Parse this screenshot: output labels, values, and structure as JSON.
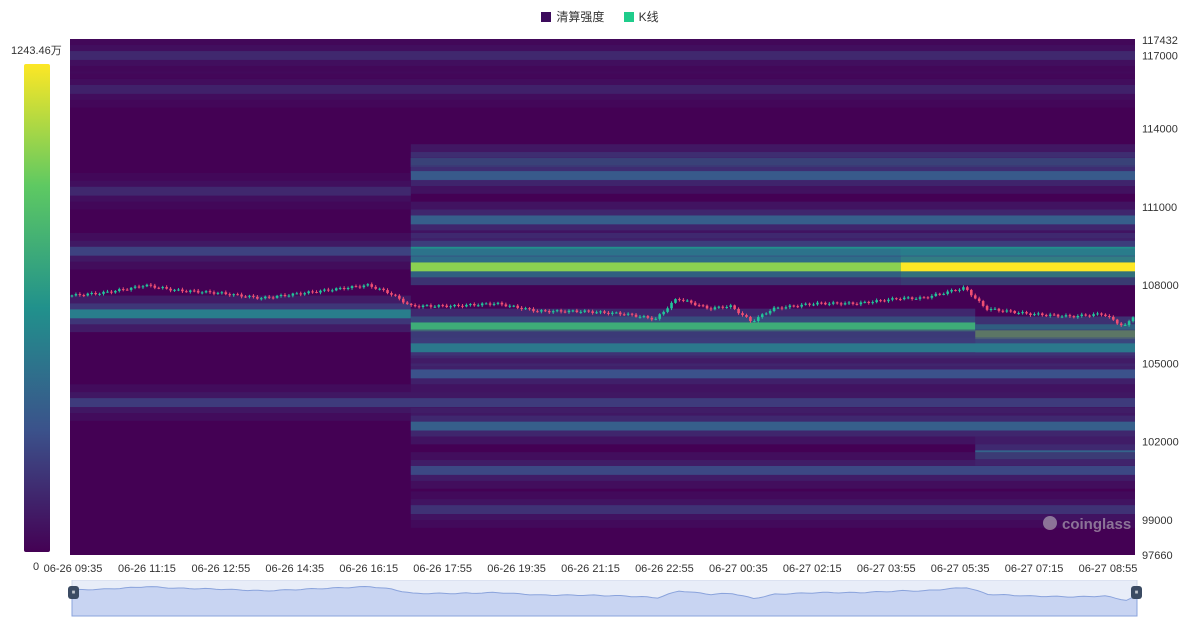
{
  "legend": {
    "items": [
      {
        "label": "清算强度",
        "color": "#3c0b5c"
      },
      {
        "label": "K线",
        "color": "#1fcc8b"
      }
    ]
  },
  "colors": {
    "up": "#22c59a",
    "down": "#ef4f73",
    "heat_low": "#440154",
    "heat_high": "#f2ed24"
  },
  "color_scale": {
    "max_label": "1243.46万",
    "min_label": "0"
  },
  "watermark": "coinglass",
  "slider": {
    "left_handle": "⏸",
    "right_handle": "⏸",
    "range_start": 0,
    "range_end": 1
  },
  "chart_data": {
    "type": "heatmap",
    "title": "",
    "legend_position": "top-center",
    "x_ticks": [
      "06-26 09:35",
      "06-26 11:15",
      "06-26 12:55",
      "06-26 14:35",
      "06-26 16:15",
      "06-26 17:55",
      "06-26 19:35",
      "06-26 21:15",
      "06-26 22:55",
      "06-27 00:35",
      "06-27 02:15",
      "06-27 03:55",
      "06-27 05:35",
      "06-27 07:15",
      "06-27 08:55"
    ],
    "y_ticks": [
      117432,
      117000,
      114000,
      111000,
      108000,
      105000,
      102000,
      99000,
      97660
    ],
    "y_range": [
      97660,
      117432
    ],
    "intensity_range": [
      0,
      12434600
    ],
    "liquidation_bands": [
      {
        "price": 116800,
        "t_start": 0.0,
        "t_end": 1.0,
        "intensity": 0.12
      },
      {
        "price": 115500,
        "t_start": 0.0,
        "t_end": 1.0,
        "intensity": 0.1
      },
      {
        "price": 112700,
        "t_start": 0.32,
        "t_end": 1.0,
        "intensity": 0.35
      },
      {
        "price": 112200,
        "t_start": 0.32,
        "t_end": 1.0,
        "intensity": 0.28
      },
      {
        "price": 111600,
        "t_start": 0.0,
        "t_end": 0.32,
        "intensity": 0.12
      },
      {
        "price": 110500,
        "t_start": 0.32,
        "t_end": 1.0,
        "intensity": 0.3
      },
      {
        "price": 109300,
        "t_start": 0.0,
        "t_end": 0.32,
        "intensity": 0.2
      },
      {
        "price": 109300,
        "t_start": 0.32,
        "t_end": 1.0,
        "intensity": 0.5
      },
      {
        "price": 108700,
        "t_start": 0.32,
        "t_end": 0.78,
        "intensity": 0.82
      },
      {
        "price": 108700,
        "t_start": 0.78,
        "t_end": 1.0,
        "intensity": 1.0
      },
      {
        "price": 106900,
        "t_start": 0.0,
        "t_end": 0.32,
        "intensity": 0.42
      },
      {
        "price": 106400,
        "t_start": 0.32,
        "t_end": 0.85,
        "intensity": 0.62
      },
      {
        "price": 106100,
        "t_start": 0.85,
        "t_end": 1.0,
        "intensity": 0.8
      },
      {
        "price": 105600,
        "t_start": 0.32,
        "t_end": 1.0,
        "intensity": 0.4
      },
      {
        "price": 104600,
        "t_start": 0.32,
        "t_end": 1.0,
        "intensity": 0.25
      },
      {
        "price": 103500,
        "t_start": 0.0,
        "t_end": 1.0,
        "intensity": 0.18
      },
      {
        "price": 102600,
        "t_start": 0.32,
        "t_end": 1.0,
        "intensity": 0.3
      },
      {
        "price": 101500,
        "t_start": 0.85,
        "t_end": 1.0,
        "intensity": 0.32
      },
      {
        "price": 100900,
        "t_start": 0.32,
        "t_end": 1.0,
        "intensity": 0.22
      },
      {
        "price": 99400,
        "t_start": 0.32,
        "t_end": 1.0,
        "intensity": 0.15
      }
    ],
    "price_path": [
      [
        0.0,
        107600
      ],
      [
        0.03,
        107700
      ],
      [
        0.06,
        107900
      ],
      [
        0.07,
        108000
      ],
      [
        0.1,
        107800
      ],
      [
        0.14,
        107700
      ],
      [
        0.18,
        107500
      ],
      [
        0.22,
        107700
      ],
      [
        0.26,
        107900
      ],
      [
        0.28,
        108000
      ],
      [
        0.3,
        107700
      ],
      [
        0.32,
        107200
      ],
      [
        0.36,
        107200
      ],
      [
        0.4,
        107300
      ],
      [
        0.44,
        107000
      ],
      [
        0.48,
        107000
      ],
      [
        0.52,
        106900
      ],
      [
        0.55,
        106700
      ],
      [
        0.57,
        107500
      ],
      [
        0.6,
        107100
      ],
      [
        0.62,
        107200
      ],
      [
        0.64,
        106600
      ],
      [
        0.66,
        107100
      ],
      [
        0.7,
        107300
      ],
      [
        0.74,
        107300
      ],
      [
        0.78,
        107500
      ],
      [
        0.8,
        107500
      ],
      [
        0.84,
        107900
      ],
      [
        0.86,
        107100
      ],
      [
        0.9,
        106900
      ],
      [
        0.94,
        106800
      ],
      [
        0.97,
        106900
      ],
      [
        0.99,
        106400
      ],
      [
        1.0,
        106900
      ]
    ]
  }
}
